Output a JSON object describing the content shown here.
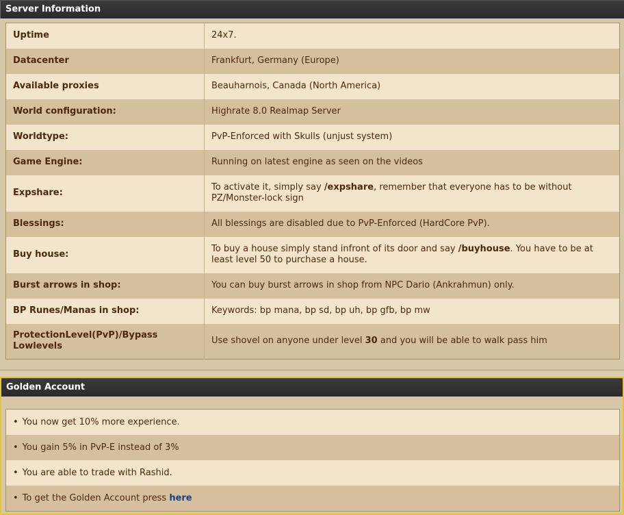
{
  "server": {
    "title": "Server Information",
    "rows": [
      {
        "key": "Uptime",
        "value": "24x7."
      },
      {
        "key": "Datacenter",
        "value": "Frankfurt, Germany (Europe)"
      },
      {
        "key": "Available proxies",
        "value": "Beauharnois, Canada (North America)"
      },
      {
        "key": "World configuration:",
        "value": "Highrate 8.0 Realmap Server"
      },
      {
        "key": "Worldtype:",
        "value": "PvP-Enforced with Skulls (unjust system)"
      },
      {
        "key": "Game Engine:",
        "value": "Running on latest engine as seen on the videos"
      },
      {
        "key": "Expshare:",
        "value_pre": "To activate it, simply say ",
        "value_bold": "/expshare",
        "value_post": ", remember that everyone has to be without PZ/Monster-lock sign"
      },
      {
        "key": "Blessings:",
        "value": "All blessings are disabled due to PvP-Enforced (HardCore PvP)."
      },
      {
        "key": "Buy house:",
        "value_pre": "To buy a house simply stand infront of its door and say ",
        "value_bold": "/buyhouse",
        "value_post": ". You have to be at least level 50 to purchase a house."
      },
      {
        "key": "Burst arrows in shop:",
        "value": "You can buy burst arrows in shop from NPC Dario (Ankrahmun) only."
      },
      {
        "key": "BP Runes/Manas in shop:",
        "value": "Keywords: bp mana, bp sd, bp uh, bp gfb, bp mw"
      },
      {
        "key": "ProtectionLevel(PvP)/Bypass Lowlevels",
        "value_pre": "Use shovel on anyone under level ",
        "value_bold": "30",
        "value_post": " and you will be able to walk pass him"
      }
    ]
  },
  "golden": {
    "title": "Golden Account",
    "bullet": "•",
    "items": [
      "You now get 10% more experience.",
      "You gain 5% in PvP-E instead of 3%",
      "You are able to trade with Rashid."
    ],
    "last_item_text": "To get the Golden Account press ",
    "last_item_link": "here"
  }
}
